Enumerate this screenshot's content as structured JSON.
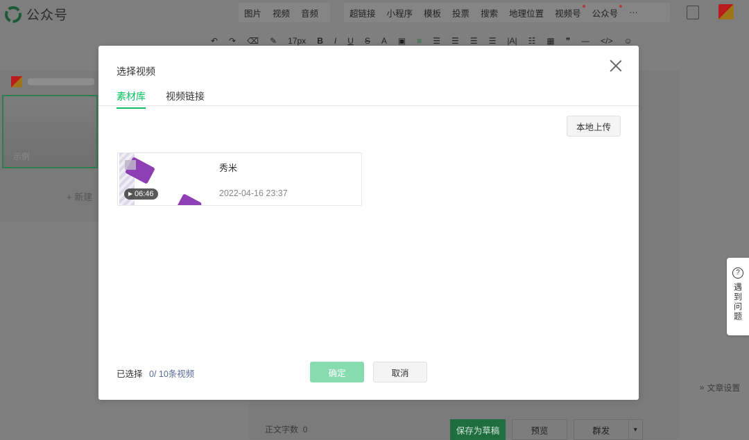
{
  "app": {
    "name": "公众号"
  },
  "menu": {
    "group1": [
      "图片",
      "视频",
      "音频"
    ],
    "group2": [
      "超链接",
      "小程序",
      "模板",
      "投票",
      "搜索",
      "地理位置",
      "视频号",
      "公众号",
      "···"
    ]
  },
  "toolbar": {
    "font_size": "17px",
    "bold": "B",
    "italic": "I",
    "underline": "U",
    "strike": "S",
    "font_color": "A",
    "quote": "❞",
    "hr": "—",
    "code": "</>"
  },
  "sidebar": {
    "article_label": "示例",
    "new_label": "+ 新建"
  },
  "help": {
    "label": "遇到问题"
  },
  "article_settings": {
    "label": "文章设置"
  },
  "footer": {
    "word_count_label": "正文字数",
    "word_count": "0",
    "save_draft": "保存为草稿",
    "preview": "预览",
    "publish": "群发"
  },
  "modal": {
    "title": "选择视频",
    "tabs": [
      "素材库",
      "视频链接"
    ],
    "upload_button": "本地上传",
    "videos": [
      {
        "title": "秀米",
        "date": "2022-04-16 23:37",
        "duration": "06:46"
      }
    ],
    "selected_label": "已选择",
    "selected_count": "0/ 10条视频",
    "confirm": "确定",
    "cancel": "取消"
  },
  "colors": {
    "accent": "#07c160",
    "link": "#576b95",
    "confirm_disabled": "#86dcae"
  }
}
